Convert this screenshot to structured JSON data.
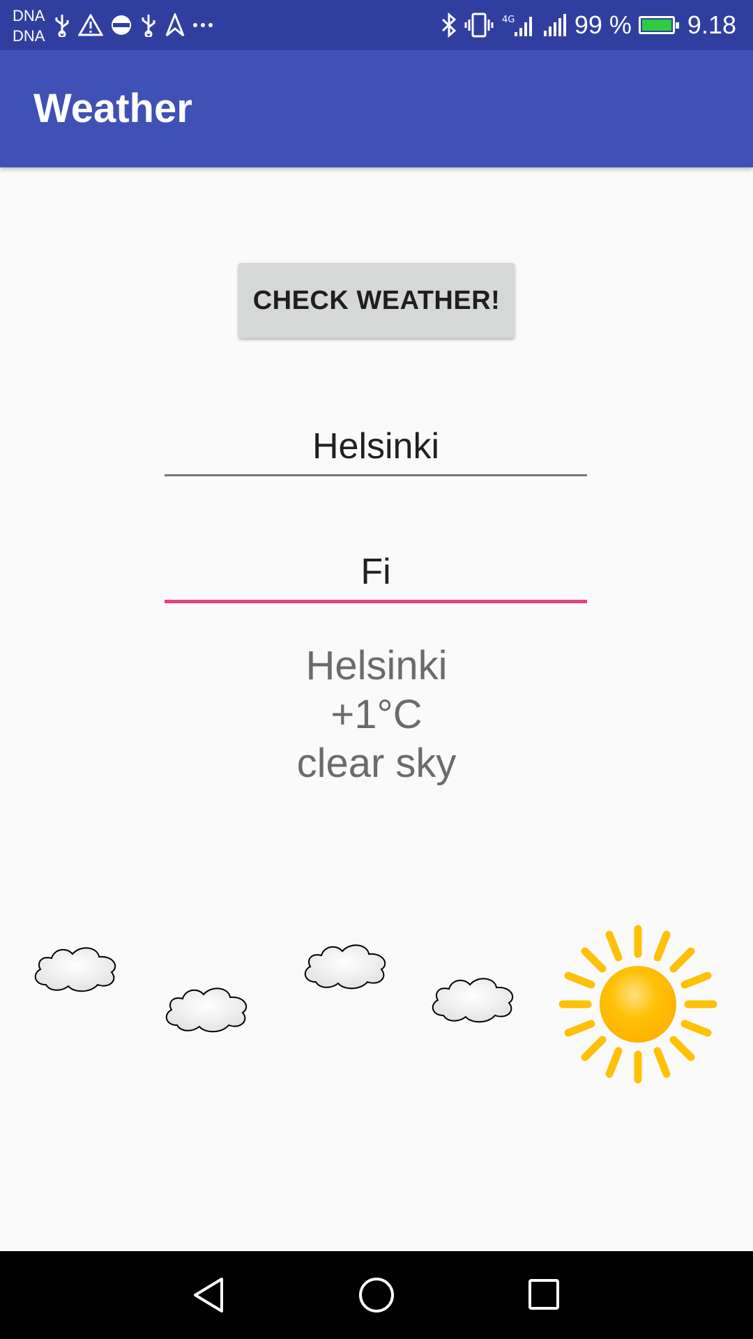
{
  "status_bar": {
    "carrier_1": "DNA",
    "carrier_2": "DNA",
    "battery_percent_label": "99 %",
    "battery_level": 0.99,
    "time": "9.18",
    "network_badge": "4G",
    "left_icons": [
      "usb-icon",
      "warning-icon",
      "sync-icon",
      "usb-icon",
      "navigation-icon",
      "more-icon"
    ],
    "right_icons": [
      "bluetooth-icon",
      "vibrate-icon",
      "4g-signal-icon",
      "cell-signal-icon",
      "battery-icon"
    ]
  },
  "app_bar": {
    "title": "Weather"
  },
  "check_button": {
    "label": "CHECK WEATHER!"
  },
  "city_input": {
    "value": "Helsinki"
  },
  "country_input": {
    "value": "Fi"
  },
  "result": {
    "city": "Helsinki",
    "temperature": "+1°C",
    "description": "clear sky"
  },
  "illustration": {
    "clouds": 4,
    "sun": true
  },
  "nav_bar": {
    "buttons": [
      "back-icon",
      "home-icon",
      "recents-icon"
    ]
  },
  "colors": {
    "status_bar": "#303F9F",
    "app_bar": "#3F51B5",
    "accent": "#EC407A",
    "button": "#D6D7D7",
    "sun": "#FFC107"
  }
}
